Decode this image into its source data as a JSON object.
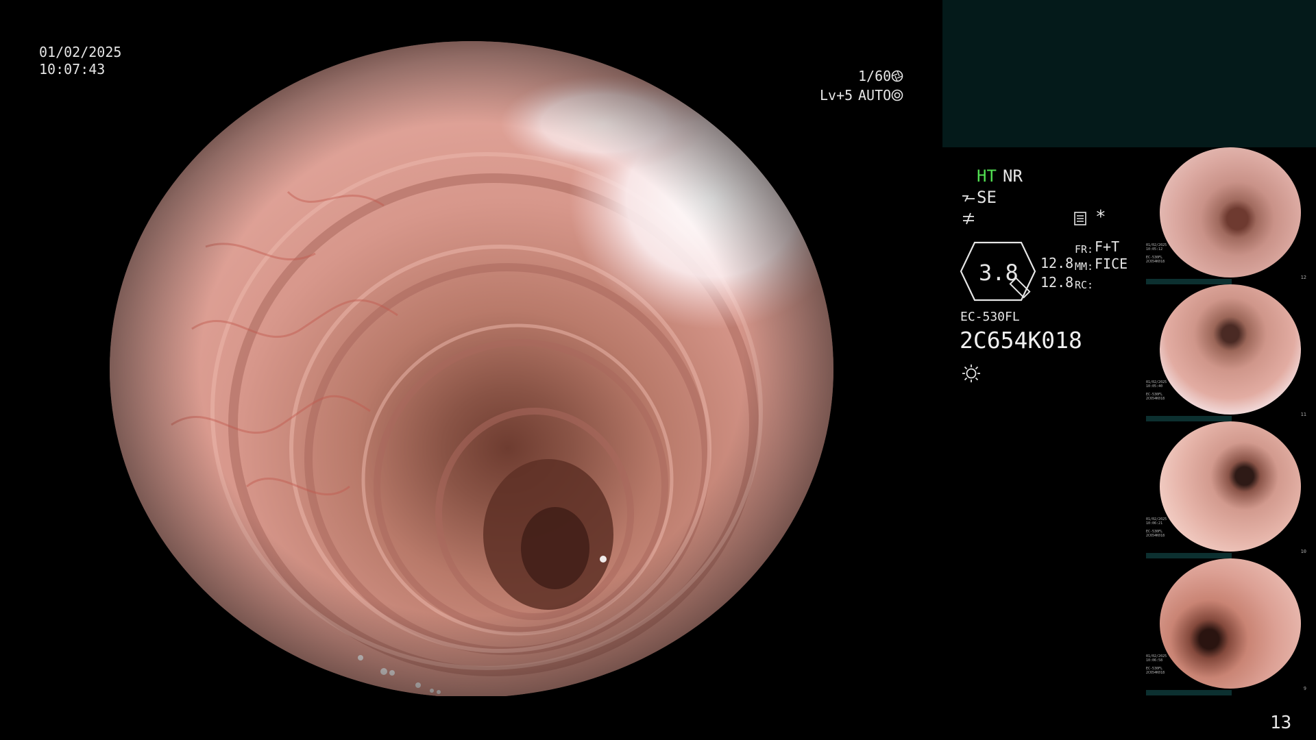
{
  "overlay": {
    "date": "01/02/2025",
    "time": "10:07:43",
    "shutter": "1/60",
    "level": "Lv+5",
    "iris_mode": "AUTO"
  },
  "status": {
    "ht_label": "HT",
    "nr_label": "NR",
    "se_label": "SE",
    "zoom_value": "3.8",
    "value_a": "12.8",
    "value_b": "12.8",
    "fr_label": "FR:",
    "fr_value": "F+T",
    "mm_label": "MM:",
    "mm_value": "FICE",
    "rc_label": "RC:",
    "scope_model": "EC-530FL",
    "scope_serial": "2C654K018"
  },
  "thumbnails": [
    {
      "info": "01/02/2025\n10:05:12\n\nEC-530FL\n2C654K018",
      "index": "12"
    },
    {
      "info": "01/02/2025\n10:05:40\n\nEC-530FL\n2C654K018",
      "index": "11"
    },
    {
      "info": "01/02/2025\n10:06:21\n\nEC-530FL\n2C654K018",
      "index": "10"
    },
    {
      "info": "01/02/2025\n10:06:58\n\nEC-530FL\n2C654K018",
      "index": "9"
    }
  ],
  "page_number": "13",
  "colors": {
    "panel": "#041a1a",
    "accent_green": "#52e152",
    "mucosa": "#d9968e"
  },
  "icons": [
    "shutter-icon",
    "iris-icon",
    "structure-enhance-icon",
    "edge-icon",
    "memory-card-icon",
    "asterisk-icon",
    "light-source-icon"
  ]
}
